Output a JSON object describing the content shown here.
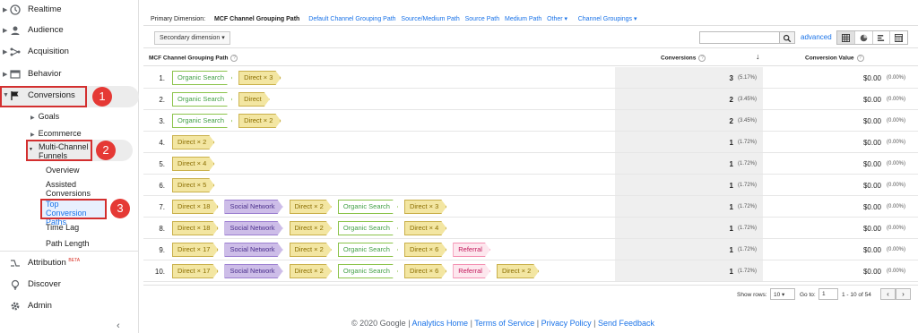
{
  "sidebar": {
    "realtime": "Realtime",
    "audience": "Audience",
    "acquisition": "Acquisition",
    "behavior": "Behavior",
    "conversions": "Conversions",
    "goals": "Goals",
    "ecommerce": "Ecommerce",
    "mcf_line1": "Multi-Channel",
    "mcf_line2": "Funnels",
    "overview": "Overview",
    "assisted_line1": "Assisted",
    "assisted_line2": "Conversions",
    "tcp_line1": "Top Conversion",
    "tcp_line2": "Paths",
    "time_lag": "Time Lag",
    "path_length": "Path Length",
    "attribution": "Attribution",
    "beta": "BETA",
    "discover": "Discover",
    "admin": "Admin",
    "callouts": [
      "1",
      "2",
      "3"
    ]
  },
  "primary_dimension": {
    "label": "Primary Dimension:",
    "current": "MCF Channel Grouping Path",
    "links": [
      "Default Channel Grouping Path",
      "Source/Medium Path",
      "Source Path",
      "Medium Path",
      "Other ▾",
      "Channel Groupings ▾"
    ]
  },
  "toolbar": {
    "secondary_dimension": "Secondary dimension ▾",
    "advanced": "advanced"
  },
  "table": {
    "col_path": "MCF Channel Grouping Path",
    "col_conversions": "Conversions",
    "col_value": "Conversion Value",
    "rows": [
      {
        "n": "1.",
        "path": [
          {
            "t": "organic",
            "l": "Organic Search"
          },
          {
            "t": "direct",
            "l": "Direct × 3"
          }
        ],
        "conv": "3",
        "pct": "(5.17%)",
        "val": "$0.00",
        "vpct": "(0.00%)"
      },
      {
        "n": "2.",
        "path": [
          {
            "t": "organic",
            "l": "Organic Search"
          },
          {
            "t": "direct",
            "l": "Direct"
          }
        ],
        "conv": "2",
        "pct": "(3.45%)",
        "val": "$0.00",
        "vpct": "(0.00%)"
      },
      {
        "n": "3.",
        "path": [
          {
            "t": "organic",
            "l": "Organic Search"
          },
          {
            "t": "direct",
            "l": "Direct × 2"
          }
        ],
        "conv": "2",
        "pct": "(3.45%)",
        "val": "$0.00",
        "vpct": "(0.00%)"
      },
      {
        "n": "4.",
        "path": [
          {
            "t": "direct",
            "l": "Direct × 2"
          }
        ],
        "conv": "1",
        "pct": "(1.72%)",
        "val": "$0.00",
        "vpct": "(0.00%)"
      },
      {
        "n": "5.",
        "path": [
          {
            "t": "direct",
            "l": "Direct × 4"
          }
        ],
        "conv": "1",
        "pct": "(1.72%)",
        "val": "$0.00",
        "vpct": "(0.00%)"
      },
      {
        "n": "6.",
        "path": [
          {
            "t": "direct",
            "l": "Direct × 5"
          }
        ],
        "conv": "1",
        "pct": "(1.72%)",
        "val": "$0.00",
        "vpct": "(0.00%)"
      },
      {
        "n": "7.",
        "path": [
          {
            "t": "direct",
            "l": "Direct × 18"
          },
          {
            "t": "social",
            "l": "Social Network"
          },
          {
            "t": "direct",
            "l": "Direct × 2"
          },
          {
            "t": "organic",
            "l": "Organic Search"
          },
          {
            "t": "direct",
            "l": "Direct × 3"
          }
        ],
        "conv": "1",
        "pct": "(1.72%)",
        "val": "$0.00",
        "vpct": "(0.00%)"
      },
      {
        "n": "8.",
        "path": [
          {
            "t": "direct",
            "l": "Direct × 18"
          },
          {
            "t": "social",
            "l": "Social Network"
          },
          {
            "t": "direct",
            "l": "Direct × 2"
          },
          {
            "t": "organic",
            "l": "Organic Search"
          },
          {
            "t": "direct",
            "l": "Direct × 4"
          }
        ],
        "conv": "1",
        "pct": "(1.72%)",
        "val": "$0.00",
        "vpct": "(0.00%)"
      },
      {
        "n": "9.",
        "path": [
          {
            "t": "direct",
            "l": "Direct × 17"
          },
          {
            "t": "social",
            "l": "Social Network"
          },
          {
            "t": "direct",
            "l": "Direct × 2"
          },
          {
            "t": "organic",
            "l": "Organic Search"
          },
          {
            "t": "direct",
            "l": "Direct × 6"
          },
          {
            "t": "referral",
            "l": "Referral"
          }
        ],
        "conv": "1",
        "pct": "(1.72%)",
        "val": "$0.00",
        "vpct": "(0.00%)"
      },
      {
        "n": "10.",
        "path": [
          {
            "t": "direct",
            "l": "Direct × 17"
          },
          {
            "t": "social",
            "l": "Social Network"
          },
          {
            "t": "direct",
            "l": "Direct × 2"
          },
          {
            "t": "organic",
            "l": "Organic Search"
          },
          {
            "t": "direct",
            "l": "Direct × 6"
          },
          {
            "t": "referral",
            "l": "Referral"
          },
          {
            "t": "direct",
            "l": "Direct × 2"
          }
        ],
        "conv": "1",
        "pct": "(1.72%)",
        "val": "$0.00",
        "vpct": "(0.00%)"
      }
    ]
  },
  "pagination": {
    "show_rows": "Show rows:",
    "rows_value": "10 ▾",
    "goto": "Go to:",
    "goto_value": "1",
    "range": "1 - 10 of 54"
  },
  "footer": {
    "copyright": "© 2020 Google",
    "links": [
      "Analytics Home",
      "Terms of Service",
      "Privacy Policy",
      "Send Feedback"
    ]
  },
  "colors": {
    "callout_red": "#e53935",
    "link_blue": "#1a73e8",
    "organic_green": "#8bc34a",
    "direct_yellow": "#f3e6a2",
    "social_purple": "#cdbde8",
    "referral_pink": "#fde7ee"
  }
}
